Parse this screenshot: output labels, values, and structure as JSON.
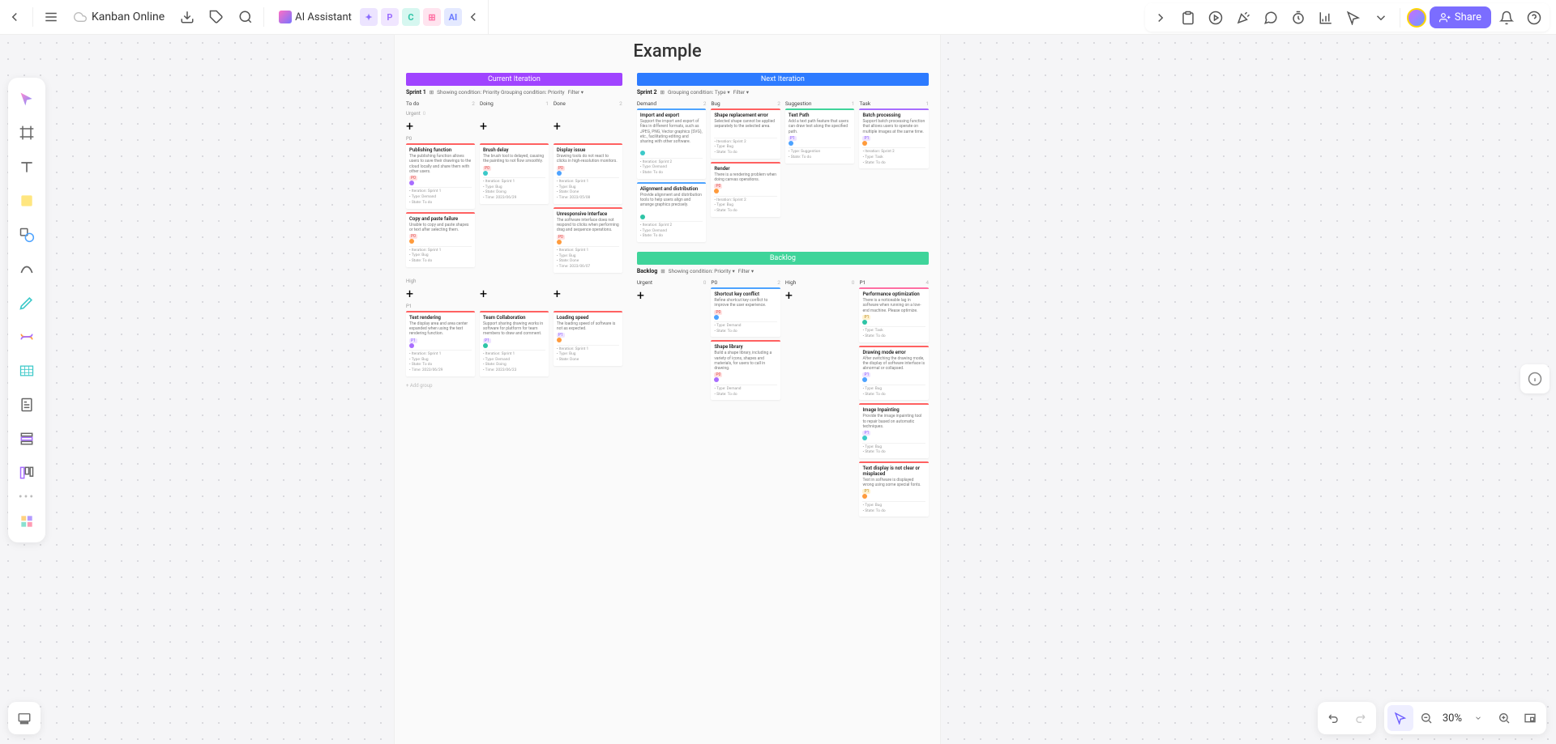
{
  "app": {
    "doc_name": "Kanban Online",
    "ai_label": "AI Assistant",
    "share": "Share"
  },
  "zoom": "30%",
  "page": {
    "title": "Example"
  },
  "phases": {
    "current": "Current Iteration",
    "next": "Next Iteration",
    "backlog": "Backlog"
  },
  "sprints": {
    "s1": {
      "name": "Sprint 1",
      "grouping": "Showing condition: Priority Grouping condition: Priority",
      "filter": "Filter ▾"
    },
    "s2": {
      "name": "Sprint 2",
      "grouping": "Grouping condition: Type ▾",
      "filter": "Filter ▾"
    },
    "bl": {
      "name": "Backlog",
      "grouping": "Showing condition: Priority ▾",
      "filter": "Filter ▾"
    }
  },
  "add_group": "+ Add group",
  "sprint1": {
    "columns": [
      {
        "name": "To do",
        "count": 2
      },
      {
        "name": "Doing",
        "count": 1
      },
      {
        "name": "Done",
        "count": 2
      }
    ],
    "groups": {
      "urgent": {
        "label": "Urgent",
        "count": 0
      },
      "p0": {
        "label": "P0",
        "todo": [
          {
            "top": "red",
            "title": "Publishing function",
            "desc": "The publishing function allows users to save their drawings to the cloud locally and share them with other users.",
            "badge": "P0",
            "bclass": "b-red",
            "dot": "d-purple",
            "meta": [
              "Iteration: Sprint 1",
              "Type: Demand",
              "State: To do"
            ]
          },
          {
            "top": "red",
            "title": "Copy and paste failure",
            "desc": "Unable to copy and paste shapes or text after selecting them.",
            "badge": "P0",
            "bclass": "b-red",
            "dot": "d-orange",
            "meta": [
              "Iteration: Sprint 1",
              "Type: Bug",
              "State: To do"
            ]
          }
        ],
        "doing": [
          {
            "top": "red",
            "title": "Brush delay",
            "desc": "The brush tool is delayed, causing the painting to not flow smoothly.",
            "badge": "P0",
            "bclass": "b-red",
            "dot": "d-cyan",
            "meta": [
              "Iteration: Sprint 1",
              "Type: Bug",
              "State: Doing",
              "Time: 2023/06/29"
            ]
          }
        ],
        "done": [
          {
            "top": "red",
            "title": "Display issue",
            "desc": "Drawing tools do not react to clicks in high-resolution monitors.",
            "badge": "P0",
            "bclass": "b-red",
            "dot": "d-blue",
            "meta": [
              "Iteration: Sprint 1",
              "Type: Bug",
              "State: Done",
              "Time: 2023/05/08"
            ]
          },
          {
            "top": "red",
            "title": "Unresponsive Interface",
            "desc": "The software interface does not respond to clicks when performing drag and sequence operations.",
            "badge": "P0",
            "bclass": "b-red",
            "dot": "d-orange",
            "meta": [
              "Iteration: Sprint 1",
              "Type: Bug",
              "State: Done",
              "Time: 2023/06/07"
            ]
          }
        ]
      },
      "high": {
        "label": "High",
        "todo": [],
        "doing": [],
        "done": []
      },
      "p1": {
        "label": "P1",
        "todo": [
          {
            "top": "red",
            "title": "Text rendering",
            "desc": "The display area and area center expanded when using the text rendering function.",
            "badge": "P1",
            "bclass": "b-purple",
            "dot": "d-purple",
            "meta": [
              "Iteration: Sprint 1",
              "Type: Bug",
              "State: To do",
              "Time: 2023/06/29"
            ]
          }
        ],
        "doing": [
          {
            "top": "red",
            "title": "Team Collaboration",
            "desc": "Support sharing drawing works in software for platform for team members to draw and comment.",
            "badge": "P1",
            "bclass": "b-purple",
            "dot": "d-teal",
            "meta": [
              "Iteration: Sprint 1",
              "Type: Demand",
              "State: Doing",
              "Time: 2023/06/23"
            ]
          }
        ],
        "done": [
          {
            "top": "red",
            "title": "Loading speed",
            "desc": "The loading speed of software is not as expected.",
            "badge": "P1",
            "bclass": "b-purple",
            "dot": "d-orange",
            "meta": [
              "Iteration: Sprint 1",
              "Type: Bug",
              "State: Done"
            ]
          }
        ]
      }
    }
  },
  "sprint2": {
    "columns": [
      {
        "name": "Demand",
        "count": 2
      },
      {
        "name": "Bug",
        "count": 2
      },
      {
        "name": "Suggestion",
        "count": 1
      },
      {
        "name": "Task",
        "count": 1
      }
    ],
    "demand": [
      {
        "top": "blue",
        "title": "Import and export",
        "desc": "Support the import and export of files in different formats, such as JPEG, PNG, Vector graphics (SVG), etc., facilitating editing and sharing with other software.",
        "badge": "",
        "bclass": "",
        "dot": "d-cyan",
        "meta": [
          "Iteration: Sprint 2",
          "Type: Demand",
          "State: To do"
        ]
      },
      {
        "top": "blue",
        "title": "Alignment and distribution",
        "desc": "Provide alignment and distribution tools to help users align and arrange graphics precisely.",
        "badge": "",
        "bclass": "",
        "dot": "d-teal",
        "meta": [
          "Iteration: Sprint 2",
          "Type: Demand",
          "State: To do"
        ]
      }
    ],
    "bug": [
      {
        "top": "red",
        "title": "Shape replacement error",
        "desc": "Selected shape cannot be applied separately to the selected area.",
        "badge": "",
        "bclass": "",
        "dot": "",
        "meta": [
          "Iteration: Sprint 2",
          "Type: Bug",
          "State: To do"
        ]
      },
      {
        "top": "red",
        "title": "Render",
        "desc": "There is a rendering problem when doing canvas operations.",
        "badge": "P0",
        "bclass": "b-red",
        "dot": "d-orange",
        "meta": [
          "Iteration: Sprint 2",
          "Type: Bug",
          "State: To do"
        ]
      }
    ],
    "suggestion": [
      {
        "top": "green",
        "title": "Text Path",
        "desc": "Add a text path feature that users can draw text along the specified path.",
        "badge": "P1",
        "bclass": "b-purple",
        "dot": "d-blue",
        "meta": [
          "Type: Suggestion",
          "State: To do"
        ]
      }
    ],
    "task": [
      {
        "top": "purple",
        "title": "Batch processing",
        "desc": "Support batch processing function that allows users to operate on multiple images at the same time.",
        "badge": "P1",
        "bclass": "b-purple",
        "dot": "d-orange",
        "meta": [
          "Iteration: Sprint 2",
          "Type: Task",
          "State: To do"
        ]
      }
    ]
  },
  "backlog": {
    "columns": [
      {
        "name": "Urgent",
        "count": 0
      },
      {
        "name": "P0",
        "count": 2
      },
      {
        "name": "High",
        "count": 0
      },
      {
        "name": "P1",
        "count": 4
      }
    ],
    "p0": [
      {
        "top": "blue",
        "title": "Shortcut key conflict",
        "desc": "Refine shortcut key conflict to improve the user experience.",
        "badge": "P0",
        "bclass": "b-red",
        "dot": "d-blue",
        "meta": [
          "Type: Demand",
          "State: To do"
        ]
      },
      {
        "top": "red",
        "title": "Shape library",
        "desc": "Build a shape library, including a variety of icons, shapes and materials, for users to call in drawing.",
        "badge": "P0",
        "bclass": "b-red",
        "dot": "d-purple",
        "meta": [
          "Type: Demand",
          "State: To do"
        ]
      }
    ],
    "p1": [
      {
        "top": "pink",
        "title": "Performance optimization",
        "desc": "There is a noticeable lag in software when running on a low-end machine. Please optimize.",
        "badge": "P1",
        "bclass": "b-yellow",
        "dot": "d-teal",
        "meta": [
          "Type: Task",
          "State: To do"
        ]
      },
      {
        "top": "red",
        "title": "Drawing mode error",
        "desc": "After switching the drawing mode, the display of software interface is abnormal or collapsed.",
        "badge": "P1",
        "bclass": "b-purple",
        "dot": "d-blue",
        "meta": [
          "Type: Bug",
          "State: To do"
        ]
      },
      {
        "top": "red",
        "title": "Image Inpainting",
        "desc": "Provide the image inpainting tool to repair based on automatic techniques.",
        "badge": "P1",
        "bclass": "b-purple",
        "dot": "d-cyan",
        "meta": [
          "Type: Bug",
          "State: To do"
        ]
      },
      {
        "top": "red",
        "title": "Text display is not clear or misplaced",
        "desc": "Text in software is displayed wrong using some special fonts.",
        "badge": "P1",
        "bclass": "b-yellow",
        "dot": "d-orange",
        "meta": [
          "Type: Bug",
          "State: To do"
        ]
      }
    ]
  }
}
